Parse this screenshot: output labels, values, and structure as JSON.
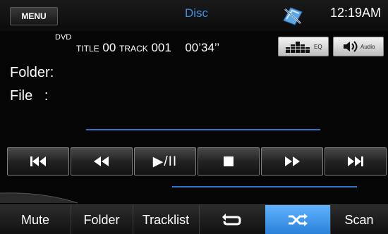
{
  "header": {
    "menu_label": "MENU",
    "source_title": "Disc",
    "clock": "12:19AM",
    "nav_icon": "satellite-nav-icon"
  },
  "info": {
    "disc_type": "DVD",
    "title_label": "TITLE",
    "title_value": "00",
    "track_label": "TRACK",
    "track_value": "001",
    "elapsed": "00’34’’"
  },
  "toolbar": {
    "eq_label": "EQ",
    "audio_label": "Audio"
  },
  "labels": {
    "folder": "Folder:",
    "file": "File   :"
  },
  "transport": {
    "buttons": [
      "previous-track",
      "rewind",
      "play-pause",
      "stop",
      "fast-forward",
      "next-track"
    ],
    "play_pause_label": "▶/II"
  },
  "bottom_bar": {
    "items": [
      "Mute",
      "Folder",
      "Tracklist",
      "Repeat",
      "Shuffle",
      "Scan"
    ],
    "active": "Shuffle"
  },
  "colors": {
    "accent": "#3f8fe0",
    "progress_line": "#2f74c6",
    "active_button": "#3e96ef"
  }
}
